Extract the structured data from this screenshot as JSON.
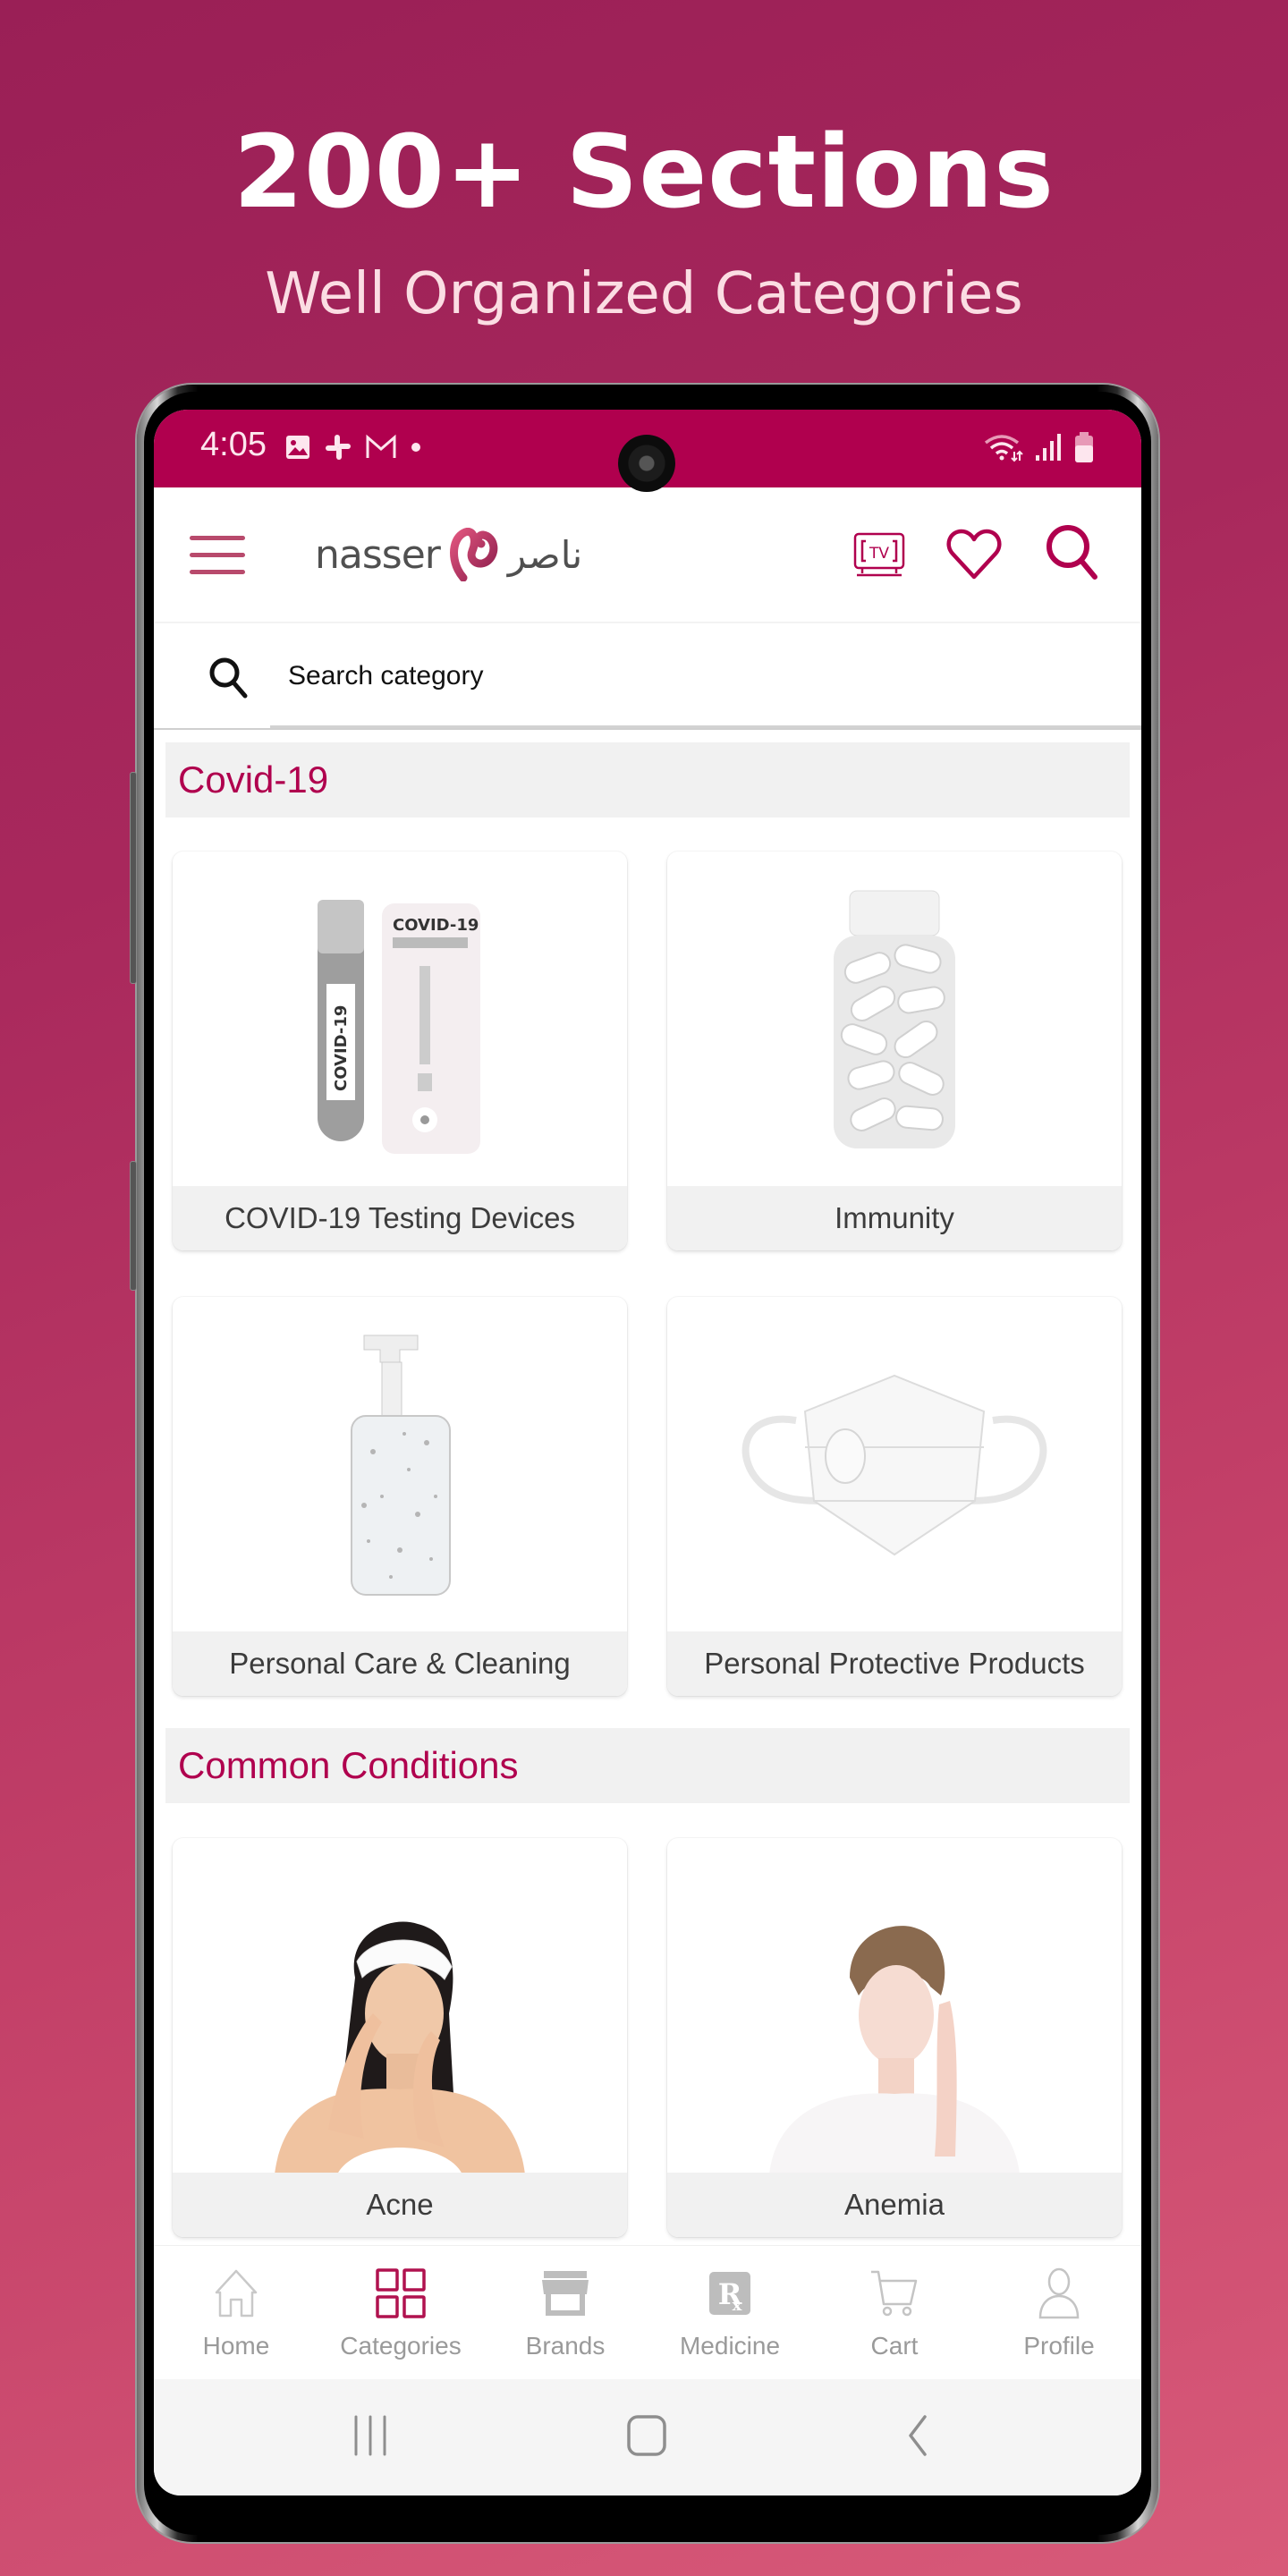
{
  "promo": {
    "title": "200+ Sections",
    "subtitle": "Well Organized Categories"
  },
  "status_bar": {
    "time": "4:05",
    "left_icons": [
      "gallery-icon",
      "slack-icon",
      "gmail-icon",
      "dot-icon"
    ],
    "right_icons": [
      "wifi-icon",
      "signal-icon",
      "battery-icon"
    ]
  },
  "header": {
    "logo_text_en": "nasser",
    "logo_text_ar": "ناصر",
    "menu_icon": "hamburger-icon",
    "actions": [
      "tv-icon",
      "heart-icon",
      "search-icon"
    ],
    "tv_label": "TV"
  },
  "search": {
    "placeholder": "Search category",
    "value": ""
  },
  "sections": [
    {
      "title": "Covid-19",
      "items": [
        {
          "label": "COVID-19 Testing Devices",
          "image": "covid-test-kit"
        },
        {
          "label": "Immunity",
          "image": "pill-bottle"
        },
        {
          "label": "Personal Care & Cleaning",
          "image": "sanitizer-bottle"
        },
        {
          "label": "Personal Protective Products",
          "image": "face-mask"
        }
      ]
    },
    {
      "title": "Common Conditions",
      "items": [
        {
          "label": "Acne",
          "image": "woman-acne"
        },
        {
          "label": "Anemia",
          "image": "woman-headache"
        }
      ]
    }
  ],
  "bottom_nav": {
    "active_index": 1,
    "items": [
      {
        "label": "Home",
        "icon": "home-icon"
      },
      {
        "label": "Categories",
        "icon": "grid-icon"
      },
      {
        "label": "Brands",
        "icon": "store-icon"
      },
      {
        "label": "Medicine",
        "icon": "rx-icon"
      },
      {
        "label": "Cart",
        "icon": "cart-icon"
      },
      {
        "label": "Profile",
        "icon": "profile-icon"
      }
    ]
  },
  "colors": {
    "brand": "#b0004e",
    "section_title": "#b0004e",
    "nav_inactive": "#9a9a9a",
    "nav_active_icon": "#b0124f"
  }
}
